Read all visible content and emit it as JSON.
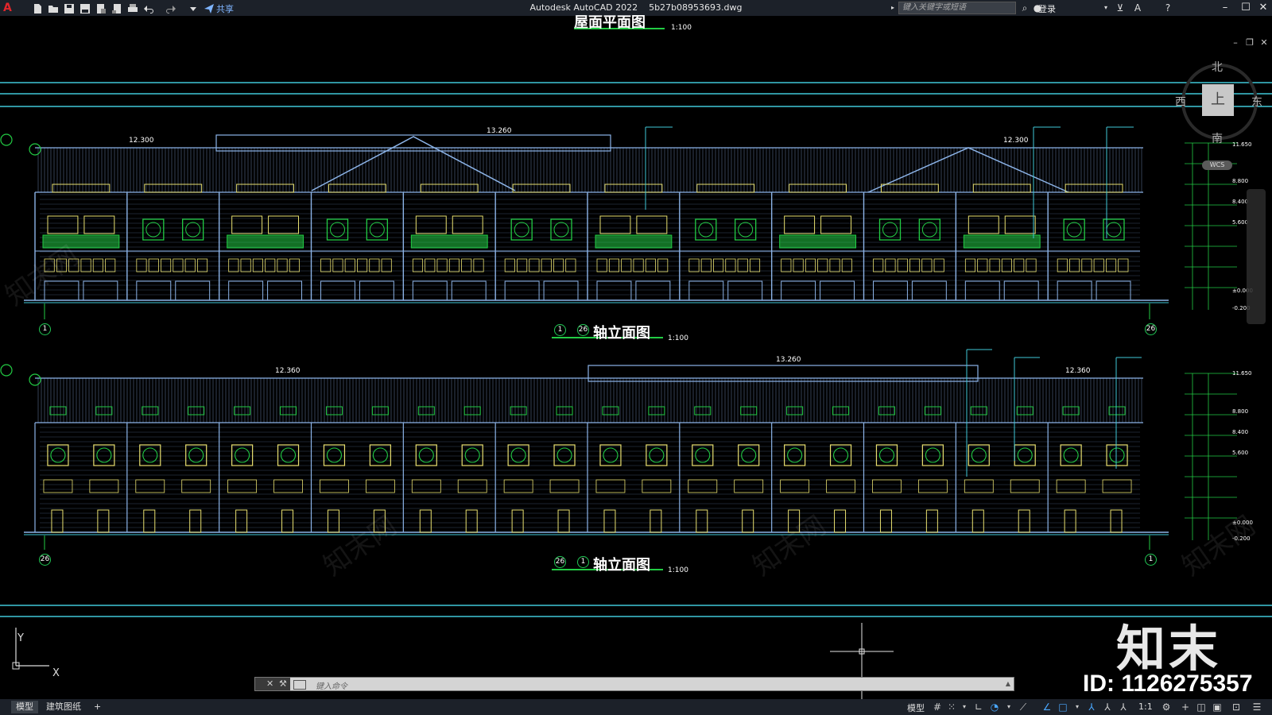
{
  "window": {
    "app_title": "Autodesk AutoCAD 2022",
    "file_name": "5b27b08953693.dwg",
    "share_label": "共享",
    "search_placeholder": "键入关键字或短语",
    "login_label": "登录"
  },
  "drawing": {
    "top_title": "屋面平面图",
    "top_scale": "1:100",
    "elevations": [
      {
        "axis_start": "1",
        "axis_end": "26",
        "title_suffix": "轴立面图",
        "scale": "1:100",
        "left_bubble": "1",
        "right_bubble": "26",
        "elev_labels": [
          "12.300",
          "13.260",
          "12.300"
        ],
        "level_marks": [
          "11.650",
          "8.800",
          "8.400",
          "5.600",
          "±0.000",
          "-0.200"
        ]
      },
      {
        "axis_start": "26",
        "axis_end": "1",
        "title_suffix": "轴立面图",
        "scale": "1:100",
        "left_bubble": "26",
        "right_bubble": "1",
        "elev_labels": [
          "12.360",
          "13.260",
          "12.360"
        ],
        "level_marks": [
          "11.650",
          "8.800",
          "8.400",
          "5.600",
          "±0.000",
          "-0.200"
        ]
      }
    ]
  },
  "viewcube": {
    "north": "北",
    "south": "南",
    "west": "西",
    "east": "东",
    "face": "上",
    "wcs": "WCS"
  },
  "ucs": {
    "x_label": "X",
    "y_label": "Y"
  },
  "watermark": {
    "brand": "知末",
    "id_text": "ID: 1126275357"
  },
  "command_line": {
    "placeholder": "键入命令"
  },
  "status_bar": {
    "tabs": [
      {
        "label": "模型",
        "active": true
      },
      {
        "label": "建筑图纸",
        "active": false
      }
    ],
    "add_tab": "+",
    "model_label": "模型",
    "annotation_scale": "1:1"
  },
  "colors": {
    "background": "#000000",
    "titlebar": "#1c2129",
    "cyan_line": "#40c8d8",
    "green_hatch": "#22cc44",
    "yellow_window": "#e8e070",
    "facade_line": "#8cb4e8"
  }
}
